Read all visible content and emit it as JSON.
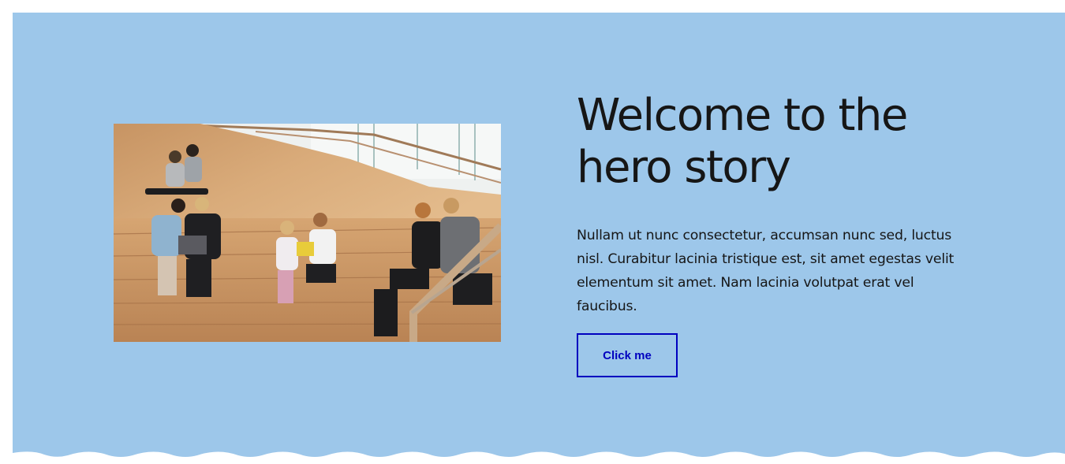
{
  "hero": {
    "title": "Welcome to the hero story",
    "body": "Nullam ut nunc consectetur, accumsan nunc sed, luctus nisl. Curabitur lacinia tristique est, sit amet egestas velit elementum sit amet. Nam lacinia volutpat erat vel faucibus.",
    "cta_label": "Click me",
    "background_color": "#9dc7ea",
    "cta_color": "#0000bf"
  }
}
